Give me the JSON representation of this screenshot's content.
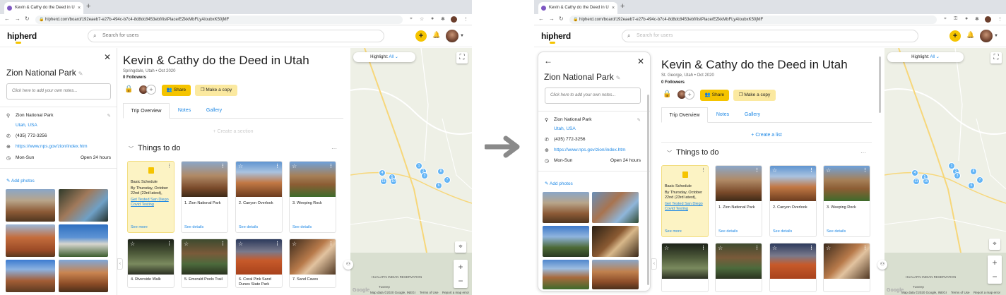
{
  "browser": {
    "tab_title": "Kevin & Cathy do the Deed in U",
    "tab_close": "×",
    "new_tab": "+",
    "url": "hipherd.com/board/192eaeb7-e27b-494c-b7c4-8d8dc8453ebf/listPlace/EZkkMbFLyAloubxK50jMF"
  },
  "app": {
    "logo": "hipherd",
    "search_placeholder": "Search for users",
    "add_button": "+"
  },
  "before": {
    "place": {
      "title": "Zion National Park",
      "notes_placeholder": "Click here to add your own notes...",
      "name": "Zion National Park",
      "region": "Utah, USA",
      "phone": "(435) 772-3256",
      "website": "https://www.nps.gov/zion/index.htm",
      "hours_days": "Mon-Sun",
      "hours_value": "Open 24 hours",
      "add_photos": "Add photos"
    },
    "trip": {
      "title": "Kevin & Cathy do the Deed in Utah",
      "subtitle": "Springdale, Utah • Oct 2020",
      "followers": "0 Followers",
      "share": "Share",
      "copy": "Make a copy",
      "tabs": [
        "Trip Overview",
        "Notes",
        "Gallery"
      ],
      "create": "+ Create a section",
      "section": "Things to do",
      "note_title": "Basic Schedule",
      "note_body": "By Thursday, October 22nd (23rd latest),",
      "note_link": "Get Tested San Diego Covid Testing",
      "see_more": "See more",
      "see_details": "See details",
      "places": [
        "1. Zion National Park",
        "2. Canyon Overlook",
        "3. Weeping Rock"
      ],
      "places_row2": [
        "4. Riverside Walk",
        "5. Emerald Pools Trail",
        "6. Coral Pink Sand Dunes State Park",
        "7. Sand Caves"
      ]
    }
  },
  "after": {
    "place": {
      "title": "Zion National Park",
      "notes_placeholder": "Click here to add your own notes...",
      "name": "Zion National Park",
      "region": "Utah, USA",
      "phone": "(435) 772-3256",
      "website": "https://www.nps.gov/zion/index.htm",
      "hours_days": "Mon-Sun",
      "hours_value": "Open 24 hours",
      "add_photos": "Add photos"
    },
    "trip": {
      "title": "Kevin & Cathy do the Deed in Utah",
      "subtitle": "St. George, Utah • Oct 2020",
      "followers": "0 Followers",
      "share": "Share",
      "copy": "Make a copy",
      "tabs": [
        "Trip Overview",
        "Notes",
        "Gallery"
      ],
      "create": "+ Create a list",
      "section": "Things to do",
      "note_title": "Basic Schedule",
      "note_body": "By Thursday, October 22nd (23rd latest),",
      "note_link": "Get Tested San Diego Covid Testing",
      "see_more": "See more",
      "see_details": "See details",
      "places": [
        "1. Zion National Park",
        "2. Canyon Overlook",
        "3. Weeping Rock"
      ]
    }
  },
  "map": {
    "highlight_label": "Highlight:",
    "highlight_value": "All",
    "pins": [
      "1",
      "2",
      "3",
      "4",
      "5",
      "6",
      "7",
      "8",
      "10",
      "11"
    ],
    "attribution": "Map data ©2020 Google, INEGI",
    "terms": "Terms of Use",
    "report": "Report a map error",
    "google": "Google",
    "zoom_in": "+",
    "zoom_out": "−",
    "reservation": "HUALAPAI INDIAN RESERVATION",
    "tuweep": "Tuweep"
  },
  "colors": {
    "accent": "#f5c400",
    "link": "#1e88e5",
    "pin": "#64b5f6"
  }
}
